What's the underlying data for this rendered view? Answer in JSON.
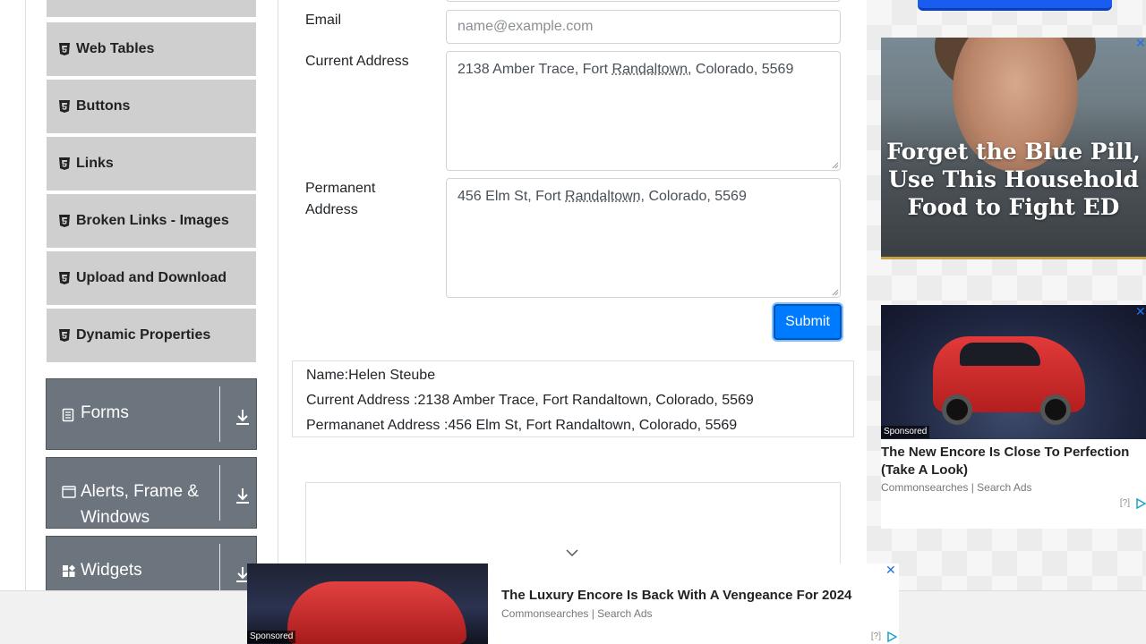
{
  "sidebar": {
    "items": [
      {
        "label": ""
      },
      {
        "label": "Web Tables"
      },
      {
        "label": "Buttons"
      },
      {
        "label": "Links"
      },
      {
        "label": "Broken Links - Images"
      },
      {
        "label": "Upload and Download"
      },
      {
        "label": "Dynamic Properties"
      }
    ],
    "groups": [
      {
        "label": "Forms",
        "icon": "document-icon"
      },
      {
        "label": "Alerts, Frame & Windows",
        "icon": "window-icon"
      },
      {
        "label": "Widgets",
        "icon": "widgets-icon"
      }
    ]
  },
  "form": {
    "email_label": "Email",
    "email_placeholder": "name@example.com",
    "current_address_label": "Current Address",
    "current_address_value": {
      "pre": "2138 Amber Trace, Fort ",
      "underlined": "Randaltown",
      "post": ", Colorado, 5569"
    },
    "permanent_address_label": "Permanent Address",
    "permanent_address_value": {
      "pre": "456 Elm St, Fort ",
      "underlined": "Randaltown",
      "post": ", Colorado, 5569"
    },
    "submit_label": "Submit"
  },
  "output": {
    "name": "Name:Helen Steube",
    "current_address": "Current Address :2138 Amber Trace, Fort Randaltown, Colorado, 5569",
    "permanent_address": "Permananet Address :456 Elm St, Fort Randaltown, Colorado, 5569"
  },
  "ads": {
    "right_top": {
      "headline": "Forget the Blue Pill, Use This Household Food to Fight ED",
      "close": "✕"
    },
    "right_bottom": {
      "sponsored": "Sponsored",
      "title": "The New Encore Is Close To Perfection (Take A Look)",
      "source": "Commonsearches | Search Ads",
      "info": "[?]",
      "close": "✕"
    },
    "bottom": {
      "sponsored": "Sponsored",
      "title": "The Luxury Encore Is Back With A Vengeance For 2024",
      "source": "Commonsearches | Search Ads",
      "info": "[?]",
      "close": "✕"
    }
  },
  "colors": {
    "primary": "#007bff",
    "group_bg": "#6c757d",
    "menu_bg": "#cfcfcf"
  }
}
